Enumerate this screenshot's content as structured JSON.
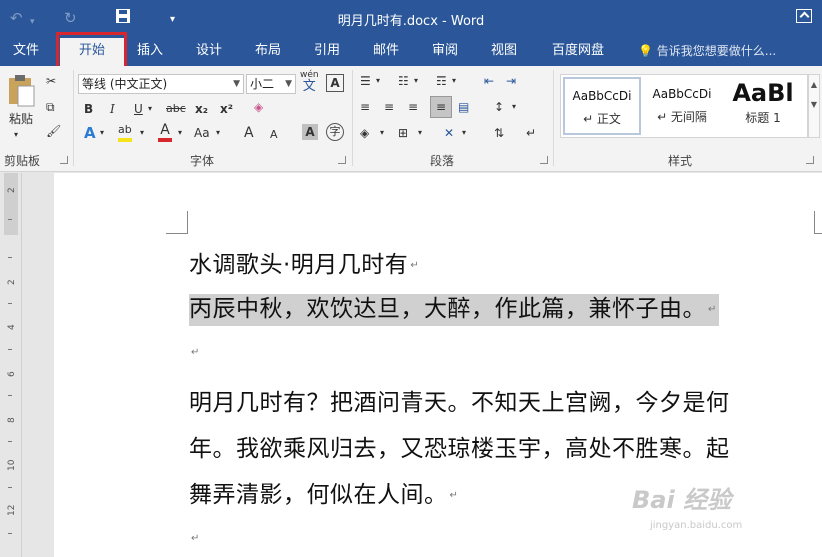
{
  "app": {
    "title": "明月几时有.docx - Word"
  },
  "qat": {
    "undo_icon": "undo-icon",
    "undo_arrow": "▾",
    "redo_icon": "redo-icon",
    "save_icon": "save-icon",
    "customize": "▾"
  },
  "tabs": [
    {
      "label": "文件"
    },
    {
      "label": "开始"
    },
    {
      "label": "插入"
    },
    {
      "label": "设计"
    },
    {
      "label": "布局"
    },
    {
      "label": "引用"
    },
    {
      "label": "邮件"
    },
    {
      "label": "审阅"
    },
    {
      "label": "视图"
    },
    {
      "label": "百度网盘"
    }
  ],
  "active_tab": "开始",
  "tell_me": "告诉我您想要做什么...",
  "ribbon": {
    "clipboard": {
      "paste_label": "粘贴",
      "group_label": "剪贴板"
    },
    "font": {
      "font_name": "等线 (中文正文)",
      "font_size": "小二",
      "phonetic_glyph": "wén",
      "phonetic_char": "文",
      "border_char": "A",
      "bold": "B",
      "italic": "I",
      "underline": "U",
      "strike": "abc",
      "subscript": "x₂",
      "superscript": "x²",
      "text_effect": "A",
      "highlight": "ab",
      "font_color": "A",
      "change_case": "Aa",
      "grow": "A",
      "shrink": "A",
      "shading_char": "A",
      "enclose_char": "字",
      "group_label": "字体"
    },
    "paragraph": {
      "group_label": "段落"
    },
    "styles": {
      "items": [
        {
          "preview": "AaBbCcDi",
          "name": "↵ 正文"
        },
        {
          "preview": "AaBbCcDi",
          "name": "↵ 无间隔"
        },
        {
          "preview": "AaBl",
          "name": "标题 1"
        }
      ],
      "group_label": "样式"
    }
  },
  "document": {
    "lines": [
      "水调歌头·明月几时有",
      "丙辰中秋，欢饮达旦，大醉，作此篇，兼怀子由。",
      "",
      "明月几时有？把酒问青天。不知天上宫阙，今夕是何",
      "年。我欲乘风归去，又恐琼楼玉宇，高处不胜寒。起",
      "舞弄清影，何似在人间。",
      ""
    ],
    "para_mark": "↵"
  },
  "ruler": {
    "labels": [
      "2",
      "2",
      "4",
      "6",
      "8",
      "10",
      "12"
    ]
  },
  "watermark": {
    "brand": "Bai 经验",
    "url": "jingyan.baidu.com"
  },
  "colors": {
    "titlebar": "#2b579a",
    "highlight_box": "#d8262f",
    "selection": "#d0d0d0"
  }
}
